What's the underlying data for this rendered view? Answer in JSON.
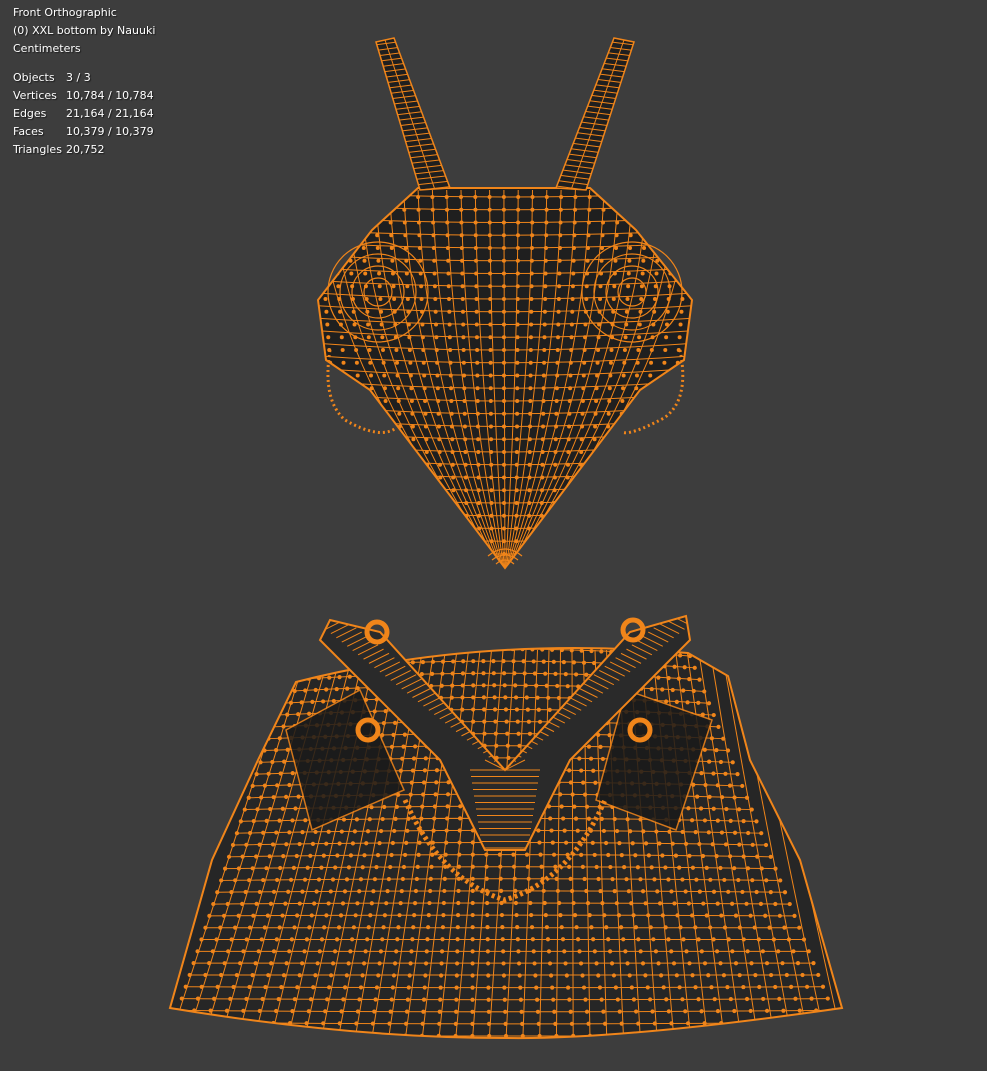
{
  "viewport": {
    "view_name": "Front Orthographic",
    "active_object": "(0) XXL bottom by Nauuki",
    "units": "Centimeters"
  },
  "stats": [
    {
      "label": "Objects",
      "value": "3 / 3"
    },
    {
      "label": "Vertices",
      "value": "10,784 / 10,784"
    },
    {
      "label": "Edges",
      "value": "21,164 / 21,164"
    },
    {
      "label": "Faces",
      "value": "10,379 / 10,379"
    },
    {
      "label": "Triangles",
      "value": "20,752"
    }
  ],
  "colors": {
    "background": "#3d3d3d",
    "wire_selected": "#f0851a",
    "mesh_fill": "#1e1e1e",
    "overlay_text": "#ffffff"
  }
}
